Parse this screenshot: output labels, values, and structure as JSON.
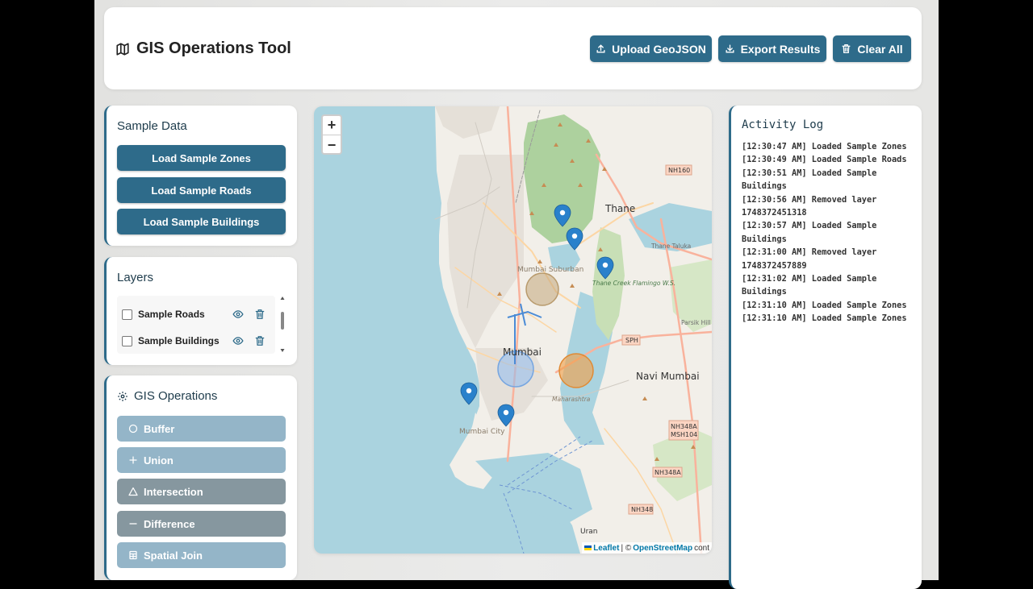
{
  "header": {
    "title": "GIS Operations Tool",
    "buttons": [
      "Upload GeoJSON",
      "Export Results",
      "Clear All"
    ]
  },
  "sample_data": {
    "title": "Sample Data",
    "buttons": [
      "Load Sample Zones",
      "Load Sample Roads",
      "Load Sample Buildings"
    ]
  },
  "layers": {
    "title": "Layers",
    "items": [
      "Sample Roads",
      "Sample Buildings"
    ]
  },
  "operations": {
    "title": "GIS Operations",
    "buttons": [
      "Buffer",
      "Union",
      "Intersection",
      "Difference",
      "Spatial Join"
    ]
  },
  "map": {
    "zoom_in": "+",
    "zoom_out": "−",
    "labels": [
      "Thane",
      "Navi Mumbai",
      "Mumbai",
      "Mumbai Suburban",
      "Mumbai City",
      "Uran",
      "Thane Creek Flamingo W.S.",
      "Maharashtra",
      "Thane Taluka",
      "Parsik Hill",
      "NH160",
      "SPH",
      "NH348A",
      "MSH104",
      "NH348"
    ],
    "attribution_leaflet": "Leaflet",
    "attribution_sep": "| ©",
    "attribution_osm": "OpenStreetMap",
    "attribution_tail": "cont"
  },
  "log": {
    "title": "Activity Log",
    "lines": [
      "[12:30:47 AM] Loaded Sample Zones",
      "[12:30:49 AM] Loaded Sample Roads",
      "[12:30:51 AM] Loaded Sample Buildings",
      "[12:30:56 AM] Removed layer 1748372451318",
      "[12:30:57 AM] Loaded Sample Buildings",
      "[12:31:00 AM] Removed layer 1748372457889",
      "[12:31:02 AM] Loaded Sample Buildings",
      "[12:31:10 AM] Loaded Sample Zones",
      "[12:31:10 AM] Loaded Sample Zones"
    ]
  },
  "colors": {
    "accent": "#2e6b8a",
    "disabled_light": "#94b5c8",
    "disabled_dark": "#86979f",
    "marker": "#2a81cb"
  }
}
